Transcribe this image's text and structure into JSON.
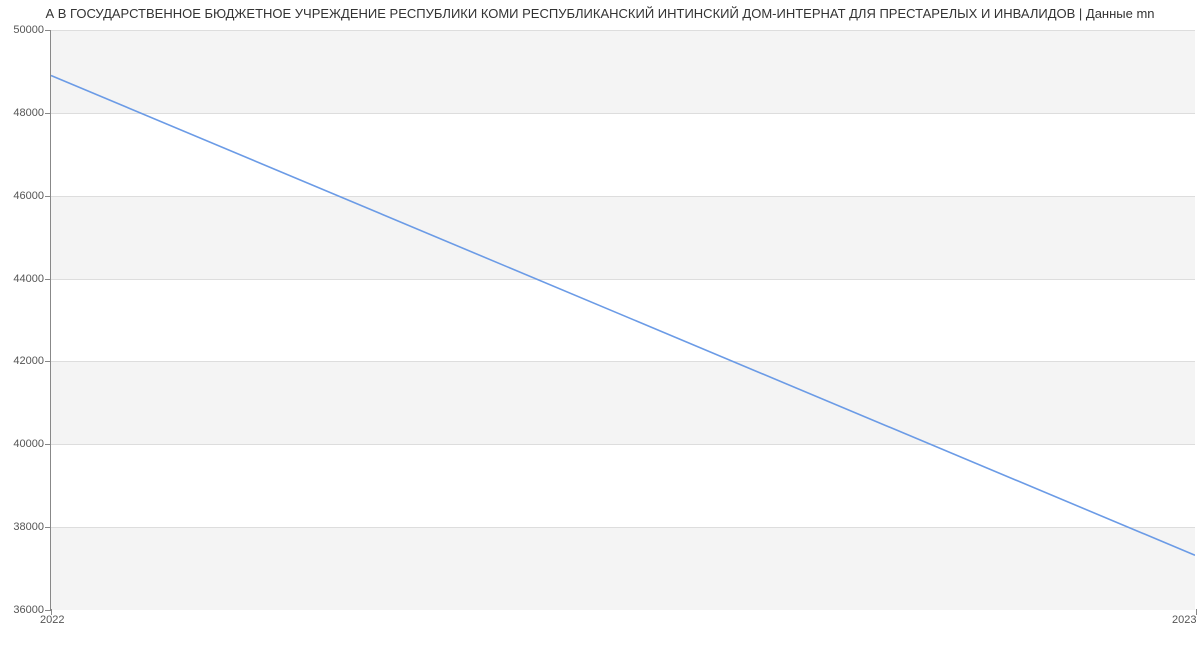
{
  "chart_data": {
    "type": "line",
    "title": "А В ГОСУДАРСТВЕННОЕ БЮДЖЕТНОЕ УЧРЕЖДЕНИЕ РЕСПУБЛИКИ КОМИ РЕСПУБЛИКАНСКИЙ ИНТИНСКИЙ ДОМ-ИНТЕРНАТ ДЛЯ ПРЕСТАРЕЛЫХ И ИНВАЛИДОВ | Данные mn",
    "x": [
      2022,
      2023
    ],
    "series": [
      {
        "name": "",
        "values": [
          48900,
          37300
        ],
        "color": "#6b9be6"
      }
    ],
    "xlabel": "",
    "ylabel": "",
    "ylim": [
      36000,
      50000
    ],
    "xlim": [
      2022,
      2023
    ],
    "x_ticks": [
      2022,
      2023
    ],
    "y_ticks": [
      36000,
      38000,
      40000,
      42000,
      44000,
      46000,
      48000,
      50000
    ]
  }
}
